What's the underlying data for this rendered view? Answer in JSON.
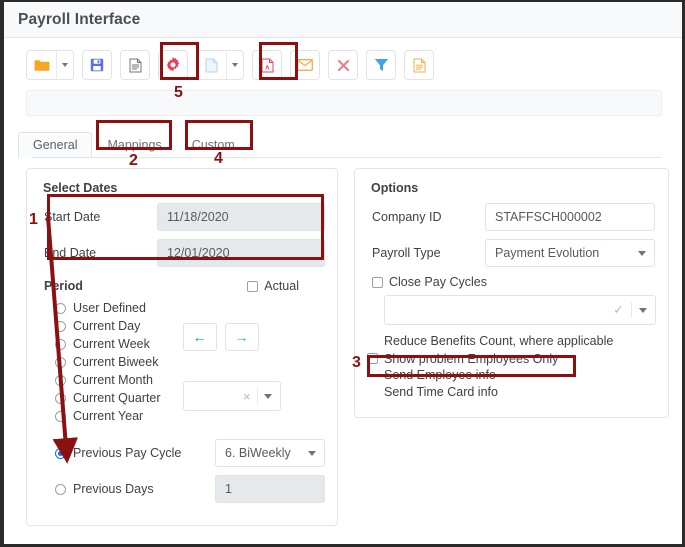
{
  "window": {
    "title": "Payroll Interface"
  },
  "toolbar": {
    "buttons": [
      {
        "name": "open-folder-button",
        "icon": "folder-icon",
        "label": "Open"
      },
      {
        "name": "open-dropdown-button",
        "icon": "chevron-down-icon",
        "label": "Open options"
      },
      {
        "name": "save-button",
        "icon": "save-disk-icon",
        "label": "Save"
      },
      {
        "name": "report-button",
        "icon": "document-lines-icon",
        "label": "Report"
      },
      {
        "name": "settings-button",
        "icon": "gear-icon",
        "label": "Settings"
      },
      {
        "name": "new-file-button",
        "icon": "blank-page-icon",
        "label": "New"
      },
      {
        "name": "new-dropdown-button",
        "icon": "chevron-down-icon",
        "label": "New options"
      },
      {
        "name": "export-pdf-button",
        "icon": "pdf-file-icon",
        "label": "Export PDF"
      },
      {
        "name": "email-button",
        "icon": "envelope-icon",
        "label": "Email"
      },
      {
        "name": "delete-button",
        "icon": "x-cross-icon",
        "label": "Delete"
      },
      {
        "name": "filter-button",
        "icon": "funnel-icon",
        "label": "Filter"
      },
      {
        "name": "notes-button",
        "icon": "yellow-document-icon",
        "label": "Notes"
      }
    ]
  },
  "tabs": [
    {
      "label": "General",
      "active": true
    },
    {
      "label": "Mappings",
      "active": false
    },
    {
      "label": "Custom",
      "active": false
    }
  ],
  "select_dates": {
    "title": "Select Dates",
    "start_date": {
      "label": "Start Date",
      "value": "11/18/2020"
    },
    "end_date": {
      "label": "End Date",
      "value": "12/01/2020"
    }
  },
  "period": {
    "label": "Period",
    "actual_checkbox": {
      "label": "Actual",
      "checked": false
    },
    "radios": [
      {
        "label": "User Defined",
        "selected": false
      },
      {
        "label": "Current Day",
        "selected": false
      },
      {
        "label": "Current Week",
        "selected": false
      },
      {
        "label": "Current Biweek",
        "selected": false
      },
      {
        "label": "Current Month",
        "selected": false
      },
      {
        "label": "Current Quarter",
        "selected": false
      },
      {
        "label": "Current Year",
        "selected": false
      },
      {
        "label": "Previous Pay Cycle",
        "selected": true
      },
      {
        "label": "Previous Days",
        "selected": false
      }
    ],
    "prev_button": {
      "icon": "arrow-left-icon",
      "glyph": "←"
    },
    "next_button": {
      "icon": "arrow-right-icon",
      "glyph": "→"
    },
    "clear_select": {
      "clear_glyph": "×",
      "value": ""
    },
    "pay_cycle_select": {
      "value": "6. BiWeekly"
    },
    "previous_days_input": {
      "value": "1"
    }
  },
  "options": {
    "title": "Options",
    "company_id": {
      "label": "Company ID",
      "value": "STAFFSCH000002"
    },
    "payroll_type": {
      "label": "Payroll Type",
      "value": "Payment Evolution"
    },
    "close_pay_cycles": {
      "label": "Close Pay Cycles",
      "checked": false
    },
    "pay_cycle_combo": {
      "value": "",
      "check_glyph": "✓"
    },
    "lines": [
      {
        "label": "Reduce Benefits Count, where applicable",
        "has_checkbox": false,
        "checked": false
      },
      {
        "label": "Show problem Employees Only",
        "has_checkbox": true,
        "checked": false
      },
      {
        "label": "Send Employee info",
        "has_checkbox": false,
        "checked": false
      },
      {
        "label": "Send Time Card info",
        "has_checkbox": false,
        "checked": false
      }
    ]
  },
  "annotations": {
    "color": "#8b1012",
    "markers": [
      {
        "id": "1",
        "text": "1",
        "target": "previous-pay-cycle-radio"
      },
      {
        "id": "2",
        "text": "2",
        "target": "tab-mappings"
      },
      {
        "id": "3",
        "text": "3",
        "target": "show-problem-employees-checkbox"
      },
      {
        "id": "4",
        "text": "4",
        "target": "tab-custom"
      },
      {
        "id": "5",
        "text": "5",
        "target": "settings-button"
      }
    ]
  },
  "colors": {
    "accent_blue": "#0c6ef2",
    "annotation_red": "#8b1012",
    "folder_orange": "#f5a623",
    "save_blue": "#5b6ee1",
    "gear_pink": "#e8415a",
    "pdf_red": "#e8415a",
    "envelope_orange": "#f0ad4e",
    "delete_red": "#e8808f",
    "filter_blue": "#3fa4e8",
    "nav_left_teal": "#0aa396",
    "nav_right_blue": "#3fa4e8"
  }
}
